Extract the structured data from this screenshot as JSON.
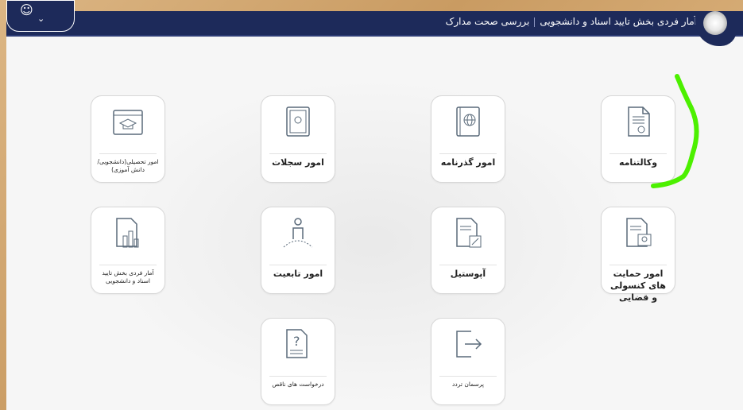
{
  "header": {
    "title_main": "آمار فردی بخش تایید اسناد و دانشجویی",
    "title_sub": "بررسی صحت مدارک"
  },
  "user_menu": {
    "icon": "user-icon",
    "chevron": "chevron-down-icon"
  },
  "tiles": [
    {
      "label": "وکالتنامه",
      "icon": "document-seal-icon"
    },
    {
      "label": "امور گذرنامه",
      "icon": "passport-icon"
    },
    {
      "label": "امور سجلات",
      "icon": "registry-book-icon"
    },
    {
      "label": "امور تحصیلی(دانشجویی/ دانش آموزی)",
      "icon": "graduation-cap-icon"
    },
    {
      "label": "امور حمایت های کنسولی و قضایی",
      "icon": "consular-support-icon"
    },
    {
      "label": "آپوستیل",
      "icon": "apostille-document-icon"
    },
    {
      "label": "امور تابعیت",
      "icon": "citizenship-person-icon"
    },
    {
      "label": "آمار فردی بخش تایید اسناد و دانشجویی",
      "icon": "statistics-chart-icon"
    },
    {
      "label": "پرسمان تردد",
      "icon": "exit-arrow-icon"
    },
    {
      "label": "درخواست های ناقص",
      "icon": "question-document-icon"
    }
  ],
  "colors": {
    "header": "#1d2a5a",
    "icon_stroke": "#5a6a7a",
    "highlight": "#4cf000"
  }
}
